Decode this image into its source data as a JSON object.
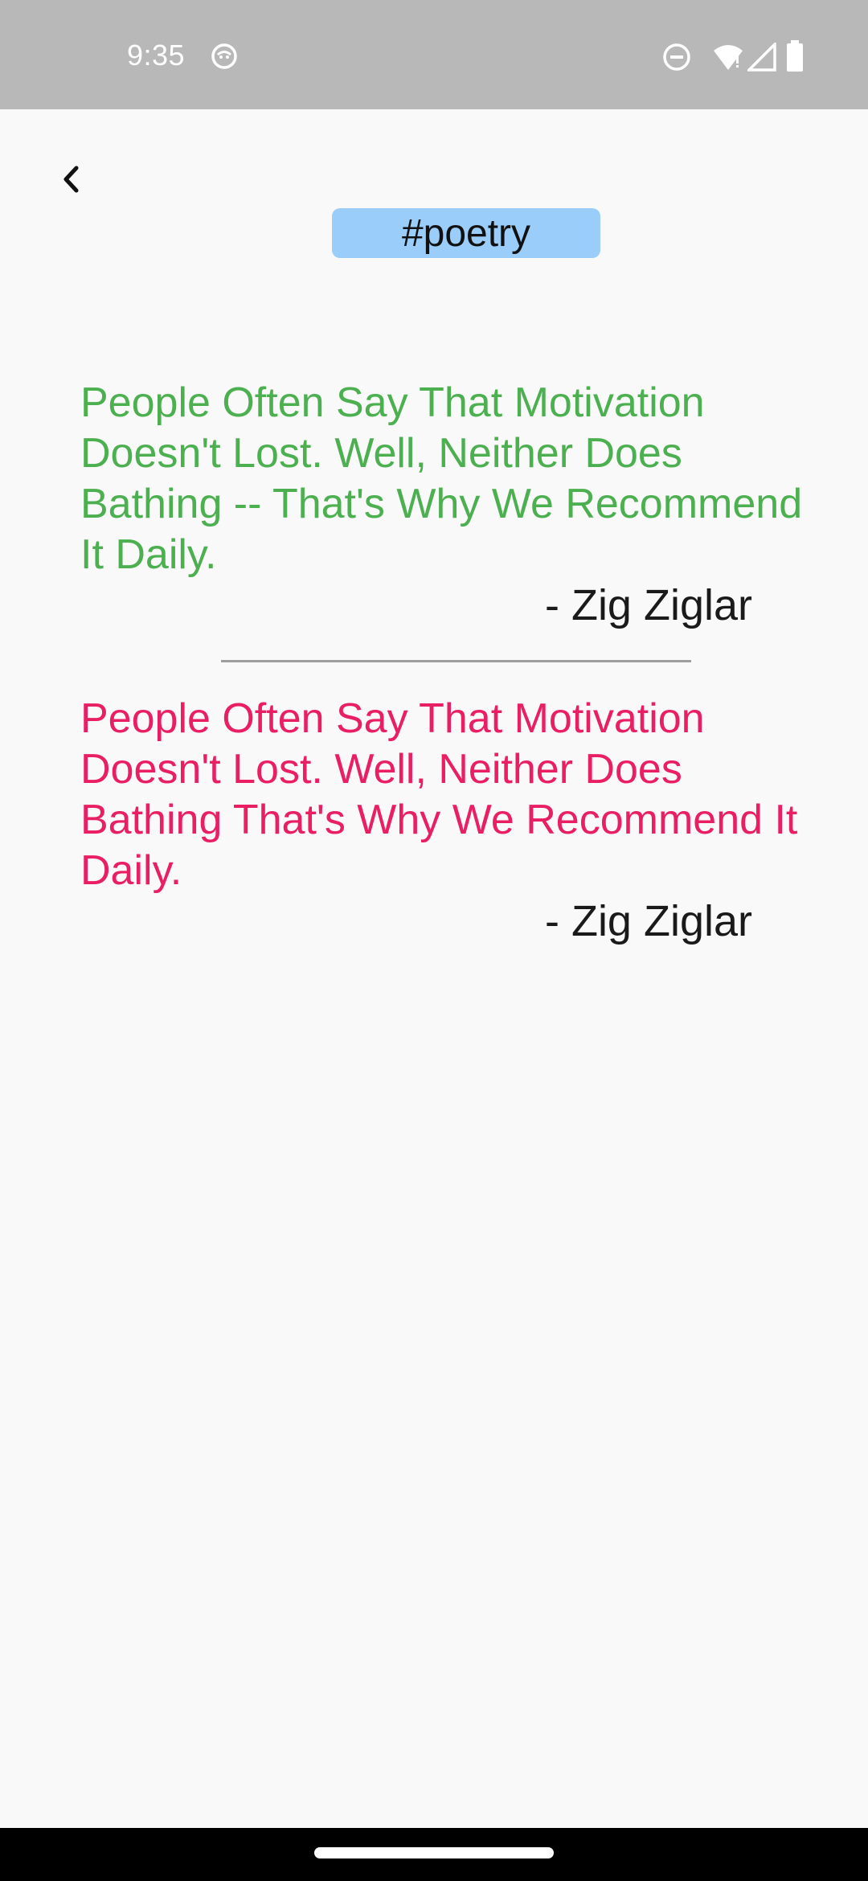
{
  "status_bar": {
    "time": "9:35",
    "icons": [
      "app-notification-icon",
      "do-not-disturb-icon",
      "wifi-icon",
      "signal-icon",
      "battery-icon"
    ]
  },
  "header": {
    "back_icon": "chevron-left-icon",
    "tag": "#poetry"
  },
  "quotes": [
    {
      "text": "People Often Say That Motivation Doesn't Lost. Well, Neither Does Bathing -- That's Why We Recommend It Daily.",
      "author": "- Zig Ziglar",
      "color": "#4caf50"
    },
    {
      "text": "People Often Say That Motivation Doesn't Lost. Well, Neither Does Bathing That's Why We Recommend It Daily.",
      "author": "- Zig Ziglar",
      "color": "#e91e63"
    }
  ],
  "colors": {
    "status_bar": "#b8b8b8",
    "background": "#f9f9f9",
    "tag_chip": "#9bcdfa",
    "divider": "#9e9e9e"
  }
}
